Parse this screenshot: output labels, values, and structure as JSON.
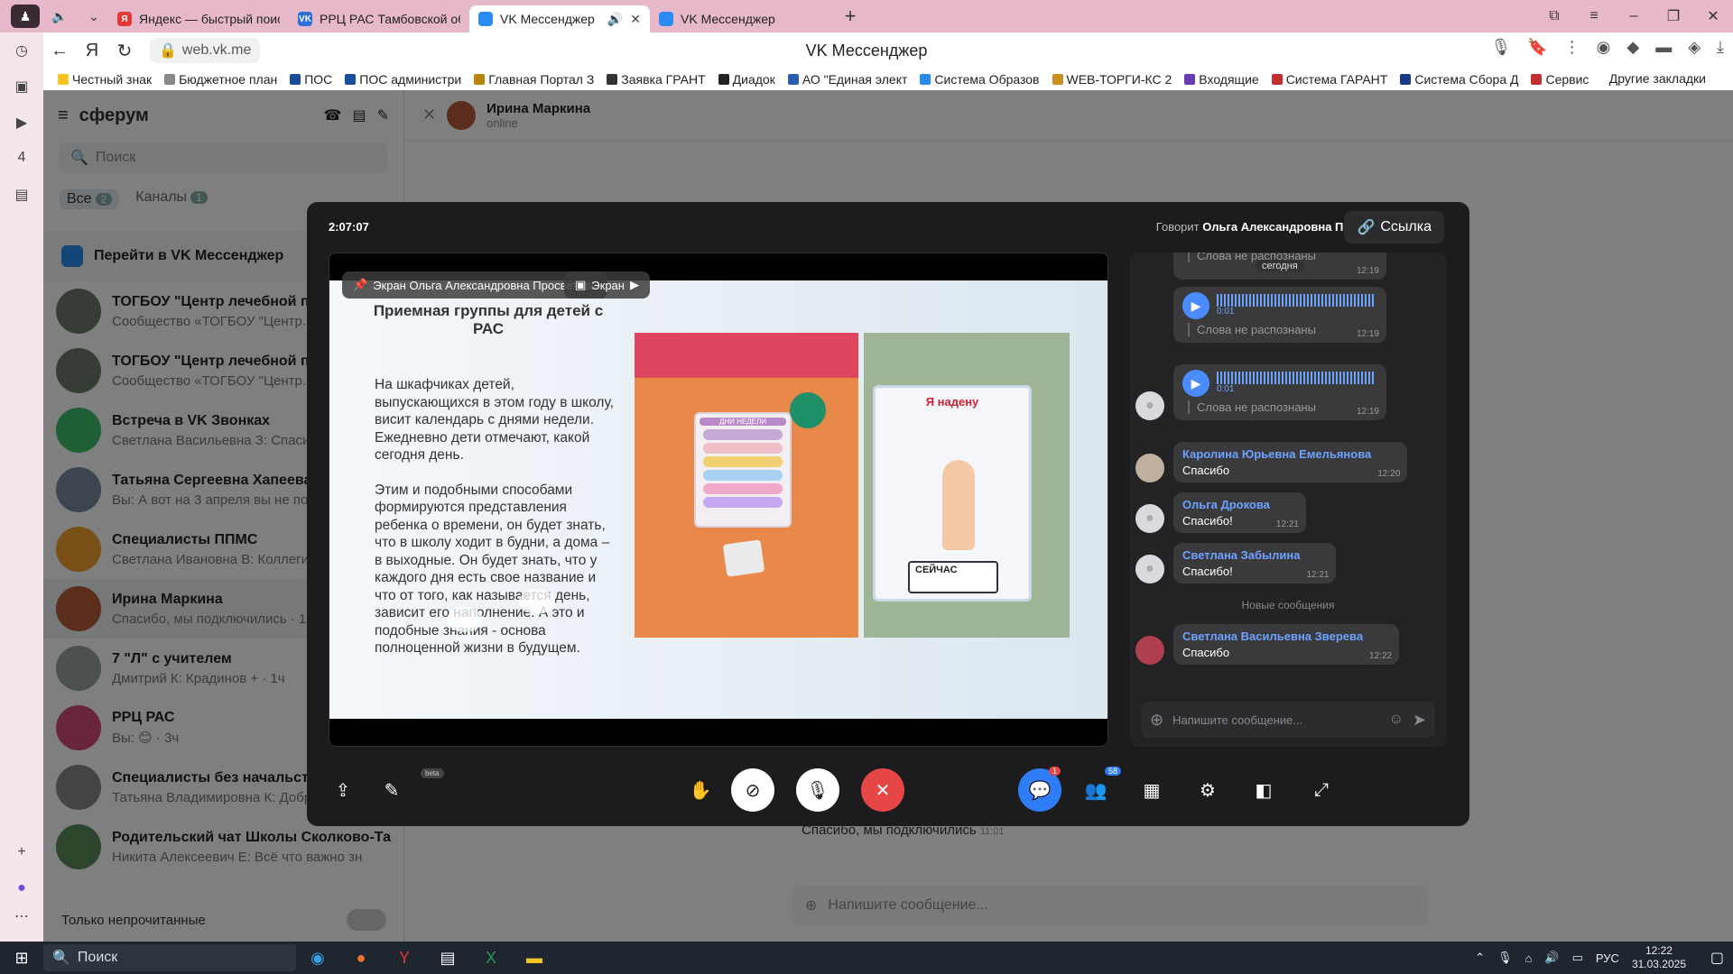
{
  "browser": {
    "tabs": [
      {
        "label": "Яндекс — быстрый поиск",
        "fav_color": "#e53935",
        "fav_text": "Я",
        "active": false
      },
      {
        "label": "РРЦ РАС Тамбовской обл",
        "fav_color": "#2a6fdb",
        "fav_text": "VK",
        "active": false
      },
      {
        "label": "VK Мессенджер",
        "fav_color": "#2a8cf0",
        "fav_text": "",
        "active": true
      },
      {
        "label": "VK Мессенджер",
        "fav_color": "#2a8cf0",
        "fav_text": "",
        "active": false
      }
    ],
    "url": "web.vk.me",
    "page_title": "VK Мессенджер",
    "bookmarks": [
      "Честный знак",
      "Бюджетное план",
      "ПОС",
      "ПОС администри",
      "Главная Портал З",
      "Заявка ГРАНТ",
      "Диадок",
      "АО \"Единая элект",
      "Система Образов",
      "WEB-ТОРГИ-КС 2",
      "Входящие",
      "Система ГАРАНТ",
      "Система Сбора Д",
      "Сервис"
    ],
    "other_bookmarks": "Другие закладки"
  },
  "sidebar": {
    "logo": "сферум",
    "search_placeholder": "Поиск",
    "tab_all": "Все",
    "tab_all_count": "2",
    "tab_channels": "Каналы",
    "tab_channels_count": "1",
    "banner": "Перейти в VK Мессенджер",
    "chats": [
      {
        "name": "ТОГБОУ \"Центр лечебной педа",
        "preview": "Сообщество «ТОГБОУ \"Центр...",
        "color": "#6b7a6a"
      },
      {
        "name": "ТОГБОУ \"Центр лечебной педа",
        "preview": "Сообщество «ТОГБОУ \"Центр...",
        "color": "#6b7a6a"
      },
      {
        "name": "Встреча в VK Звонках",
        "preview": "Светлана Васильевна З: Спасиб",
        "color": "#3fbf6a"
      },
      {
        "name": "Татьяна Сергеевна Хапеева",
        "preview": "Вы: А вот на 3 апреля вы не под",
        "color": "#7a8aa0"
      },
      {
        "name": "Специалисты ППМС",
        "preview": "Светлана Ивановна В: Коллеги,",
        "color": "#f0a030"
      },
      {
        "name": "Ирина Маркина",
        "preview": "Спасибо, мы подключились · 1ч",
        "color": "#b65a3a"
      },
      {
        "name": "7 \"Л\" с учителем",
        "preview": "Дмитрий К: Крадинов + · 1ч",
        "color": "#9aa39a"
      },
      {
        "name": "РРЦ РАС",
        "preview": "Вы: 😊 · 3ч",
        "color": "#d04a7a"
      },
      {
        "name": "Специалисты без начальства",
        "preview": "Татьяна Владимировна К: Добр",
        "color": "#888888"
      },
      {
        "name": "Родительский чат Школы Сколково-Та",
        "preview": "Никита Алексеевич Е: Всё что важно зн",
        "color": "#5a8a5a"
      }
    ],
    "unread_only": "Только непрочитанные"
  },
  "chat": {
    "name": "Ирина Маркина",
    "status": "online",
    "bg_message": "Спасибо, мы подключились",
    "bg_message_time": "11:01",
    "input_placeholder": "Напишите сообщение..."
  },
  "call": {
    "timer": "2:07:07",
    "speaking_prefix": "Говорит",
    "speaking_name": "Ольга Александровна П.",
    "link_label": "Ссылка",
    "screen_chip": "Экран Ольга Александровна Просветова",
    "screen_chip2": "Экран",
    "slide": {
      "title": "Приемная группы для детей с РАС",
      "para1": "На шкафчиках детей, выпускающихся в этом году в школу, висит календарь с днями недели. Ежедневно дети отмечают, какой сегодня день.",
      "para2": "Этим и подобными способами формируются представления ребенка о времени, он будет знать, что в школу ходит в будни, а дома – в выходные. Он будет знать, что у каждого дня есть свое название и что от того, как называется день, зависит его наполнение. А это и подобные знания - основа полноценной жизни в будущем.",
      "board_title": "Я надену",
      "board_now": "СЕЙЧАС",
      "calendar_title": "ДНИ НЕДЕЛИ"
    },
    "chat": {
      "date_chip": "сегодня",
      "voice_messages": [
        {
          "text": "Слова не распознаны",
          "time": "12:19"
        },
        {
          "duration": "0:01",
          "text": "Слова не распознаны",
          "time": "12:19"
        },
        {
          "duration": "0:01",
          "text": "Слова не распознаны",
          "time": "12:19"
        }
      ],
      "messages": [
        {
          "author": "Каролина Юрьевна Емельянова",
          "text": "Спасибо",
          "time": "12:20"
        },
        {
          "author": "Ольга Дрокова",
          "text": "Спасибо!",
          "time": "12:21"
        },
        {
          "author": "Светлана Забылина",
          "text": "Спасибо!",
          "time": "12:21"
        }
      ],
      "new_divider": "Новые сообщения",
      "new_message": {
        "author": "Светлана Васильевна Зверева",
        "text": "Спасибо",
        "time": "12:22"
      },
      "input_placeholder": "Напишите сообщение...",
      "chat_badge": "1",
      "participants_badge": "58"
    },
    "beta_label": "beta"
  },
  "taskbar": {
    "search": "Поиск",
    "lang": "РУС",
    "time": "12:22",
    "date": "31.03.2025"
  }
}
